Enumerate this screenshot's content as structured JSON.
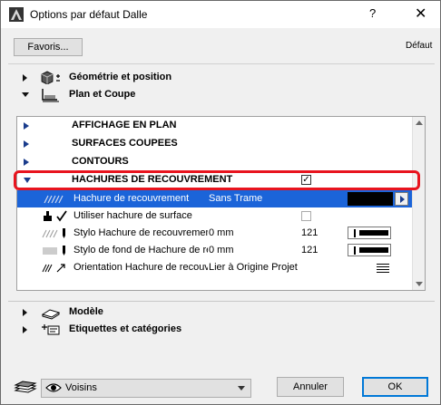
{
  "window": {
    "title": "Options par défaut Dalle",
    "help_glyph": "?",
    "close_glyph": "✕"
  },
  "toolbar": {
    "favoris_label": "Favoris...",
    "default_label": "Défaut"
  },
  "sections": {
    "geometrie": "Géométrie et position",
    "plan_coupe": "Plan et Coupe",
    "modele": "Modèle",
    "etiquettes": "Etiquettes et catégories"
  },
  "panel": {
    "groups": [
      {
        "label": "AFFICHAGE EN PLAN"
      },
      {
        "label": "SURFACES COUPEES"
      },
      {
        "label": "CONTOURS"
      },
      {
        "label": "HACHURES DE RECOUVREMENT"
      }
    ],
    "rows": [
      {
        "label": "Hachure de recouvrement",
        "value": "Sans Trame",
        "num": ""
      },
      {
        "label": "Utiliser hachure de surface",
        "value": "",
        "num": ""
      },
      {
        "label": "Stylo Hachure de recouvrement",
        "value": "0 mm",
        "num": "121"
      },
      {
        "label": "Stylo de fond de Hachure de recouvrement",
        "value": "0 mm",
        "num": "121"
      },
      {
        "label": "Orientation Hachure de recouvrement",
        "value": "Lier à Origine Projet",
        "num": ""
      }
    ],
    "checkmark_glyph": "✓"
  },
  "footer": {
    "voisins_label": "Voisins",
    "annuler_label": "Annuler",
    "ok_label": "OK"
  },
  "colors": {
    "selection": "#1b64d9",
    "highlight": "#e8141e",
    "tree_arrow": "#1a3c8c"
  },
  "icons": [
    "app-icon",
    "help-icon",
    "close-icon",
    "cube-icon",
    "plan-icon",
    "hatch-icon",
    "brush-icon",
    "pen-icon",
    "orientation-icon",
    "model-icon",
    "label-icon",
    "eye-icon",
    "layers-icon"
  ]
}
